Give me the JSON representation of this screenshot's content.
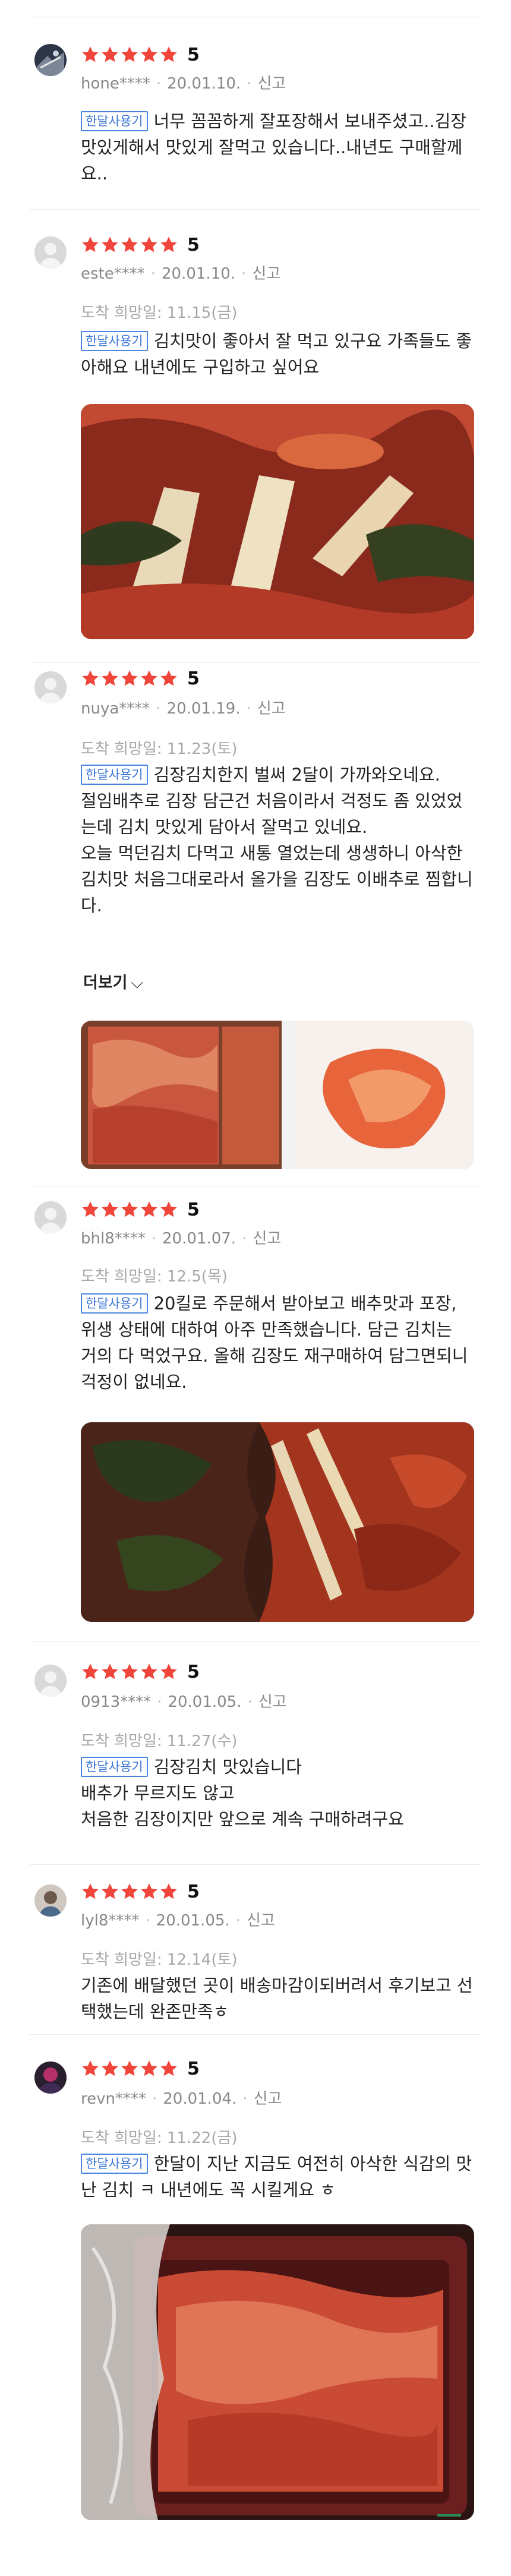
{
  "reviews": [
    {
      "rating": "5",
      "user": "hone****",
      "date": "20.01.10.",
      "report": "신고",
      "badge": "한달사용기",
      "text": "너무 꼼꼼하게 잘포장해서 보내주셨고..김장맛있게해서 맛있게 잘먹고 있습니다..내년도 구매할께요.."
    },
    {
      "rating": "5",
      "user": "este****",
      "date": "20.01.10.",
      "report": "신고",
      "delivery": "도착 희망일: 11.15(금)",
      "badge": "한달사용기",
      "text": "김치맛이 좋아서 잘 먹고 있구요 가족들도 좋아해요 내년에도 구입하고 싶어요"
    },
    {
      "rating": "5",
      "user": "nuya****",
      "date": "20.01.19.",
      "report": "신고",
      "delivery": "도착 희망일: 11.23(토)",
      "badge": "한달사용기",
      "text_line1": "김장김치한지 벌써 2달이 가까와오네요.",
      "text_line2": "절임배추로 김장 담근건 처음이라서 걱정도 좀 있었었는데 김치 맛있게 담아서 잘먹고 있네요.",
      "text_line3": "오늘 먹던김치 다먹고 새통 열었는데 생생하니 아삭한 김치맛 처음그대로라서 올가을 김장도 이배추로 찜합니다.",
      "more": "더보기"
    },
    {
      "rating": "5",
      "user": "bhl8****",
      "date": "20.01.07.",
      "report": "신고",
      "delivery": "도착 희망일: 12.5(목)",
      "badge": "한달사용기",
      "text": "20킬로 주문해서 받아보고 배추맛과 포장, 위생 상태에 대하여 아주 만족했습니다. 담근 김치는 거의 다 먹었구요. 올해 김장도 재구매하여 담그면되니 걱정이 없네요."
    },
    {
      "rating": "5",
      "user": "0913****",
      "date": "20.01.05.",
      "report": "신고",
      "delivery": "도착 희망일: 11.27(수)",
      "badge": "한달사용기",
      "text_line1": "김장김치 맛있습니다",
      "text_line2": "배추가 무르지도 않고",
      "text_line3": "처음한 김장이지만 앞으로 계속 구매하려구요"
    },
    {
      "rating": "5",
      "user": "lyl8****",
      "date": "20.01.05.",
      "report": "신고",
      "delivery": "도착 희망일: 12.14(토)",
      "text": "기존에 배달했던 곳이 배송마감이되버려서 후기보고 선택했는데 완존만족ㅎ"
    },
    {
      "rating": "5",
      "user": "revn****",
      "date": "20.01.04.",
      "report": "신고",
      "delivery": "도착 희망일: 11.22(금)",
      "badge": "한달사용기",
      "text": "한달이 지난 지금도 여전히 아삭한 식감의 맛난 김치 ㅋ 내년에도 꼭 시킬게요 ㅎ"
    }
  ],
  "colors": {
    "star": "#f0453a",
    "badge": "#3a74d6",
    "meta": "#888888"
  }
}
